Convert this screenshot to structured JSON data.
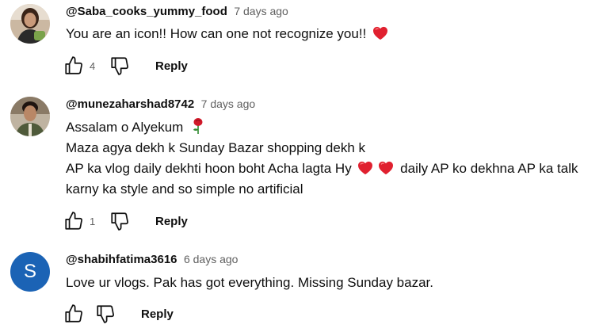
{
  "comments": [
    {
      "author": "@Saba_cooks_yummy_food",
      "time": "7 days ago",
      "lines": [
        "You are an icon!! How can one not recognize you!!"
      ],
      "likes": "4",
      "reply": "Reply"
    },
    {
      "author": "@munezaharshad8742",
      "time": "7 days ago",
      "lines": [
        "Assalam o Alyekum",
        "Maza agya dekh k Sunday Bazar shopping dekh k",
        "AP ka vlog daily dekhti hoon boht Acha lagta Hy",
        "daily AP ko dekhna AP ka talk",
        "karny ka style and so simple no artificial"
      ],
      "likes": "1",
      "reply": "Reply"
    },
    {
      "author": "@shabihfatima3616",
      "time": "6 days ago",
      "avatar_letter": "S",
      "avatar_color": "#1b63b5",
      "lines": [
        "Love ur vlogs. Pak has got everything. Missing Sunday bazar."
      ],
      "likes": "",
      "reply": "Reply"
    }
  ],
  "icons": {
    "like": "thumbs-up-icon",
    "dislike": "thumbs-down-icon",
    "heart": "red-heart-emoji",
    "rose": "rose-emoji"
  }
}
